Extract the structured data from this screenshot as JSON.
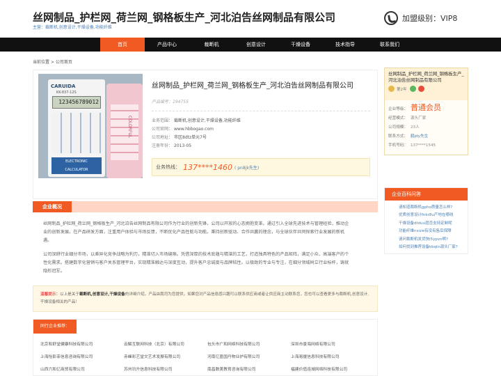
{
  "header": {
    "title": "丝网制品_护栏网_荷兰网_钢格板生产_河北泊告丝网制品有限公司",
    "subtitle": "主营：裁断机,创意设计,干燥设备,功能纤维",
    "level": "加盟级别：VIP8"
  },
  "nav": [
    {
      "label": "首页",
      "active": true
    },
    {
      "label": "产品中心"
    },
    {
      "label": "裁断机"
    },
    {
      "label": "创意设计"
    },
    {
      "label": "干燥设备"
    },
    {
      "label": "技术指导"
    },
    {
      "label": "联系我们"
    }
  ],
  "breadcrumb": "当前位置 > 公司首页",
  "product": {
    "image": {
      "brand": "CARUIDA",
      "model": "KK-837-12S",
      "screen": "123456789012",
      "label_line1": "ELECTRONIC",
      "label_line2": "CALCULATOR",
      "side_text": "COLORFUL"
    },
    "title": "丝网制品_护栏网_荷兰网_钢格板生产_河北泊告丝网制品有限公司",
    "number_label": "产品编号：",
    "number": "194755",
    "info": [
      {
        "k": "业务范围：",
        "v": "裁断机,创意设计,干燥设备,功能纤维"
      },
      {
        "k": "公司官网：",
        "v": "www.hbbogao.com"
      },
      {
        "k": "公司地址：",
        "v": "市区8dtz单元7号"
      },
      {
        "k": "注册年份：",
        "v": "2013-05"
      }
    ],
    "hotline_label": "业务热线：",
    "hotline": "137****1460",
    "contact": "( pn8jk先生)"
  },
  "intro": {
    "tab": "企业概况",
    "p1": "丝网制品_护栏网_荷兰网_钢格板生产_河北泊告丝网制品有限公司作为行业的创新先锋，公司以开放的心态拥抱变革。通过引入全球先进技术与管理经验，推动企业的创新发展。在产品研发方面，注重用户体验与市场反馈，不断优化产品性能与功能。秉持创新驱动、合作共赢的理念，与全球伙伴共同探索行业发展的新机遇。",
    "p2": "公司深耕行业细分市场，以差异化竞争战略为利刃，精准切入市场缝隙。凭借深厚的技术底蕴与精湛的工艺，打造独具特色的产品矩阵，满足小众、高端客户的个性化需求。搭建数字化营销与客户关系管理平台，实现精准触达与深度互动，提升客户忠诚度与品牌粘性。以极致的专业与专注，在细分领域树立行业标杆，铸就隐形冠军。"
  },
  "tip": {
    "prefix": "温馨提示：",
    "text1": "以上是关于",
    "highlight": "裁断机,创意设计,干燥设备",
    "text2": "的详细介绍，产品由我司为您提供，如果您对产品信息感兴趣可以联系供应商或者让供应商主动联系您，您也可以查看更多与裁断机,创意设计,干燥设备相关的产品！"
  },
  "friends": {
    "tab": "同行企业推荐：",
    "items": [
      "北京和舒堂健康科技有限公司",
      "云解互联网科技（北京）有限公司",
      "包头市广和网络科技有限公司",
      "深圳市景海网络有限公司",
      "上海怡彭菲信息咨询有限公司",
      "赤峰彩艺堂文艺术发展有限公司",
      "河南亿盈国丹物业护有限公司",
      "上海易援信息科技有限公司",
      "山西六和亿商贸有限公司",
      "苏州讯升信息科技有限公司",
      "南昌数美教育咨询有限公司",
      "福建价值连城网络科技有限公司"
    ]
  },
  "sidebar": {
    "title": "丝网制品_护栏网_荷兰网_钢格板生产_河北泊告丝网制品有限公司",
    "years": "第2年",
    "rows": [
      {
        "k": "企业等级：",
        "v": "普通会员",
        "style": "level"
      },
      {
        "k": "经营模式：",
        "v": "源头厂家"
      },
      {
        "k": "公司规模：",
        "v": "23人"
      },
      {
        "k": "联系方式：",
        "v": "鹤jdy先生",
        "style": "link"
      },
      {
        "k": "手机号码：",
        "v": "137****1545"
      }
    ],
    "qa_title": "企业百科问答",
    "qa": [
      "请知道裁断机gpho质量怎么样?",
      "优质创意设计fnkr8u产地在哪线",
      "干燥设备dtduu层否支持定制呢",
      "功能纤维nxuie有没有售后保障",
      "请问裁断机发货快i5ypvn啊?",
      "如何找到推荐设备kbqtn源头厂家?"
    ]
  },
  "colors": {
    "accent": "#f15a22",
    "nav_bg": "#111111",
    "link": "#4a7fb5"
  },
  "icons": [
    "phone-icon",
    "medal-icon",
    "shield-icon",
    "badge-icon"
  ]
}
